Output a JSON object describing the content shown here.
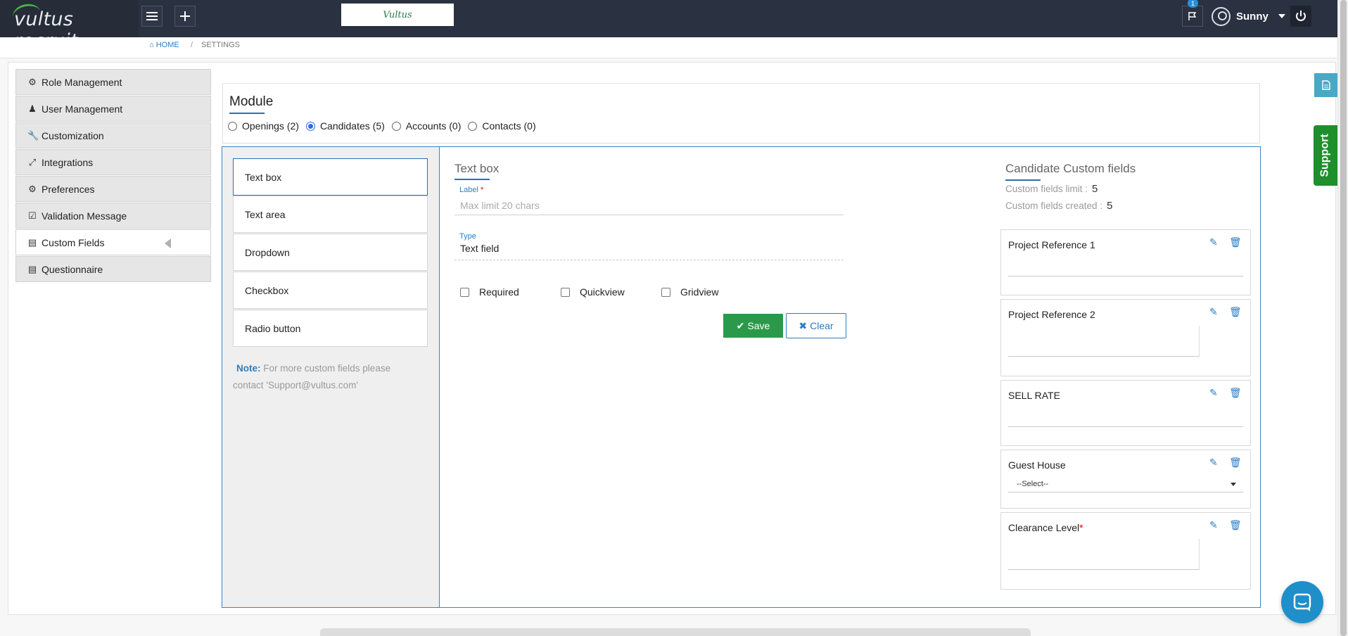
{
  "app": {
    "brand": "vultus recruit",
    "center_logo": "Vultus",
    "notification_count": "1",
    "user_name": "Sunny"
  },
  "breadcrumb": {
    "home": "HOME",
    "separator": "/",
    "current": "SETTINGS"
  },
  "sidebar": {
    "items": [
      {
        "label": "Role Management",
        "icon": "gear-icon"
      },
      {
        "label": "User Management",
        "icon": "user-icon"
      },
      {
        "label": "Customization",
        "icon": "wrench-icon"
      },
      {
        "label": "Integrations",
        "icon": "puzzle-icon"
      },
      {
        "label": "Preferences",
        "icon": "gears-icon"
      },
      {
        "label": "Validation Message",
        "icon": "checkbox-icon"
      },
      {
        "label": "Custom Fields",
        "icon": "chart-icon",
        "active": true
      },
      {
        "label": "Questionnaire",
        "icon": "chart-icon"
      }
    ]
  },
  "module": {
    "title": "Module",
    "options": [
      {
        "label": "Openings (2)",
        "selected": false
      },
      {
        "label": "Candidates (5)",
        "selected": true
      },
      {
        "label": "Accounts (0)",
        "selected": false
      },
      {
        "label": "Contacts (0)",
        "selected": false
      }
    ]
  },
  "field_types": {
    "items": [
      "Text box",
      "Text area",
      "Dropdown",
      "Checkbox",
      "Radio button"
    ],
    "active": "Text box",
    "note_label": "Note:",
    "note_text": "For more custom fields please contact 'Support@vultus.com'"
  },
  "form": {
    "title": "Text box",
    "label_caption": "Label",
    "label_required_mark": "*",
    "label_placeholder": "Max limit 20 chars",
    "type_caption": "Type",
    "type_value": "Text field",
    "checkboxes": [
      "Required",
      "Quickview",
      "Gridview"
    ],
    "save_label": "Save",
    "clear_label": "Clear"
  },
  "custom_fields": {
    "title": "Candidate Custom fields",
    "limit_label": "Custom fields limit :",
    "limit_value": "5",
    "created_label": "Custom fields created :",
    "created_value": "5",
    "fields": [
      {
        "name": "Project Reference 1",
        "kind": "text"
      },
      {
        "name": "Project Reference 2",
        "kind": "textarea"
      },
      {
        "name": "SELL RATE",
        "kind": "text"
      },
      {
        "name": "Guest House",
        "kind": "dropdown",
        "selected": "--Select--"
      },
      {
        "name": "Clearance Level",
        "kind": "textarea",
        "required_mark": "*"
      }
    ]
  },
  "side_tabs": {
    "support": "Support"
  },
  "colors": {
    "topbar": "#2a3140",
    "accent": "#2a7ec6",
    "save": "#2a9a4a",
    "support": "#1e8f2c"
  }
}
